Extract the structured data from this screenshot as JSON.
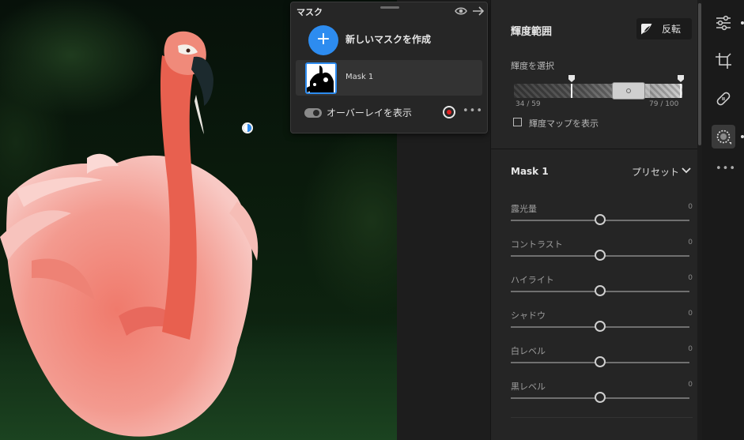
{
  "mask_panel": {
    "title": "マスク",
    "create_label": "新しいマスクを作成",
    "mask_item_name": "Mask 1",
    "overlay_label": "オーバーレイを表示",
    "more": "•••"
  },
  "luminance": {
    "title": "輝度範囲",
    "invert_label": "反転",
    "select_label": "輝度を選択",
    "range_low": "34 / 59",
    "range_high": "79 / 100",
    "show_map_label": "輝度マップを表示",
    "show_map_checked": false
  },
  "mask1": {
    "title": "Mask 1",
    "preset_label": "プリセット",
    "sliders": [
      {
        "label": "露光量",
        "value": "0"
      },
      {
        "label": "コントラスト",
        "value": "0"
      },
      {
        "label": "ハイライト",
        "value": "0"
      },
      {
        "label": "シャドウ",
        "value": "0"
      },
      {
        "label": "白レベル",
        "value": "0"
      },
      {
        "label": "黒レベル",
        "value": "0"
      }
    ]
  },
  "toolstrip": {
    "tools": [
      "sliders-icon",
      "crop-icon",
      "healing-bandage-icon",
      "masking-icon"
    ],
    "active_tool": "masking-icon",
    "more": "•••"
  },
  "colors": {
    "accent": "#2d8cf0",
    "record": "#e02020",
    "flamingo": "#e8706a"
  }
}
